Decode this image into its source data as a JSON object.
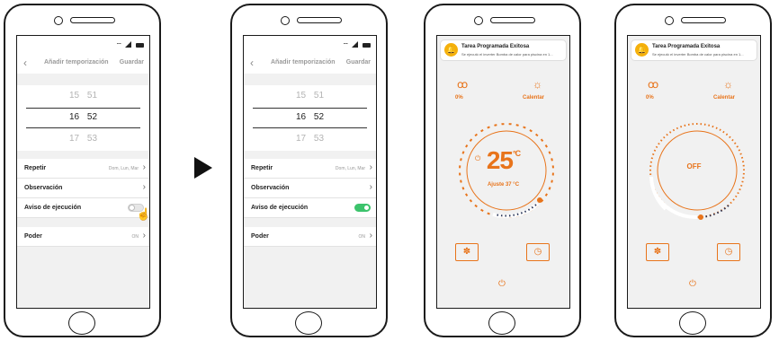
{
  "schedule": {
    "title": "Añadir temporización",
    "save": "Guardar",
    "back": "‹",
    "picker": [
      {
        "hour": "15",
        "minute": "51"
      },
      {
        "hour": "16",
        "minute": "52"
      },
      {
        "hour": "17",
        "minute": "53"
      }
    ],
    "rows": {
      "repetir": {
        "label": "Repetir",
        "value": "Dom, Lun, Mar"
      },
      "observacion": {
        "label": "Observación"
      },
      "aviso": {
        "label": "Aviso de ejecución"
      },
      "poder": {
        "label": "Poder",
        "value": "ON"
      }
    },
    "chevron": "›",
    "toggle_state_before": "off",
    "toggle_state_after": "on"
  },
  "thermostat": {
    "notification_title": "Tarea Programada Exitosa",
    "notification_body": "Se ejecutó el inverter Bomba de calor para piscina en 1...",
    "humidity_value": "0%",
    "mode_label": "Calentar",
    "temperature": "25",
    "temp_unit": "°C",
    "adjust_label": "Ajuste 37 °C",
    "off_label": "OFF"
  },
  "icons": {
    "bell": "🔔",
    "water": "ꝏ",
    "sun": "☼",
    "fan": "✽",
    "timer": "◷",
    "power": "⏻",
    "hand": "☝"
  },
  "colors": {
    "accent": "#e8741b",
    "toggle_on": "#3cc36c",
    "bell": "#f5b00b",
    "inactive_dots": "#2a3557"
  }
}
